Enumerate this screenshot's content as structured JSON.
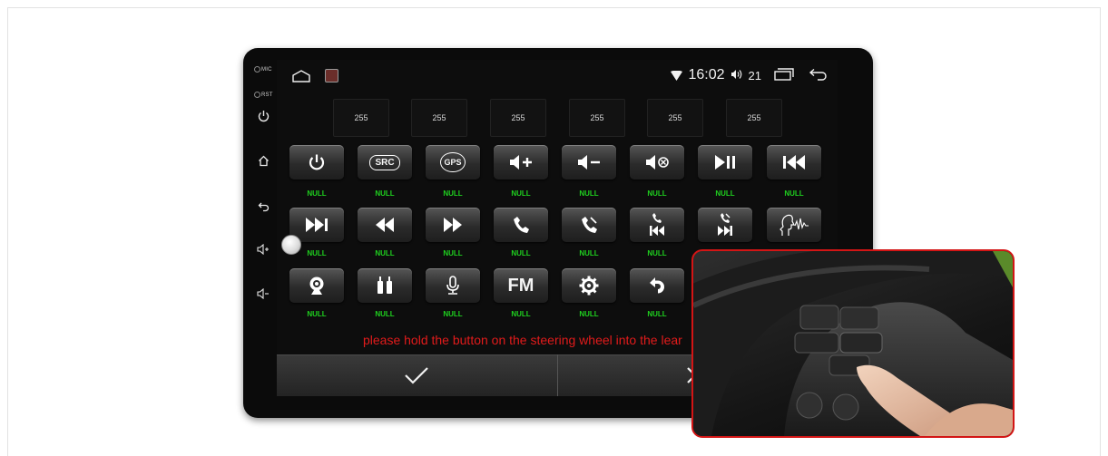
{
  "side_labels": {
    "mic": "MIC",
    "rst": "RST"
  },
  "status_bar": {
    "time": "16:02",
    "volume_level": "21"
  },
  "value_boxes": [
    "255",
    "255",
    "255",
    "255",
    "255",
    "255"
  ],
  "key_rows": [
    [
      {
        "icon": "power-icon"
      },
      {
        "icon": "src-icon",
        "text": "SRC"
      },
      {
        "icon": "gps-icon",
        "text": "GPS"
      },
      {
        "icon": "volume-up-icon"
      },
      {
        "icon": "volume-down-icon"
      },
      {
        "icon": "mute-icon"
      },
      {
        "icon": "play-pause-icon"
      },
      {
        "icon": "previous-track-icon"
      }
    ],
    [
      {
        "icon": "next-track-icon"
      },
      {
        "icon": "rewind-icon"
      },
      {
        "icon": "fast-forward-icon"
      },
      {
        "icon": "answer-call-icon"
      },
      {
        "icon": "hang-up-icon"
      },
      {
        "icon": "call-previous-icon"
      },
      {
        "icon": "call-next-icon"
      },
      {
        "icon": "voice-command-icon"
      }
    ],
    [
      {
        "icon": "camera-icon"
      },
      {
        "icon": "rca-audio-icon"
      },
      {
        "icon": "microphone-icon"
      },
      {
        "icon": "fm-radio-icon",
        "text": "FM"
      },
      {
        "icon": "settings-gear-icon"
      },
      {
        "icon": "back-arrow-icon"
      }
    ]
  ],
  "null_label": "NULL",
  "prompt": "please hold the button on the steering wheel into the lear",
  "colors": {
    "prompt": "#e21b1b",
    "null_text": "#1fd11f",
    "inset_border": "#d31515"
  }
}
